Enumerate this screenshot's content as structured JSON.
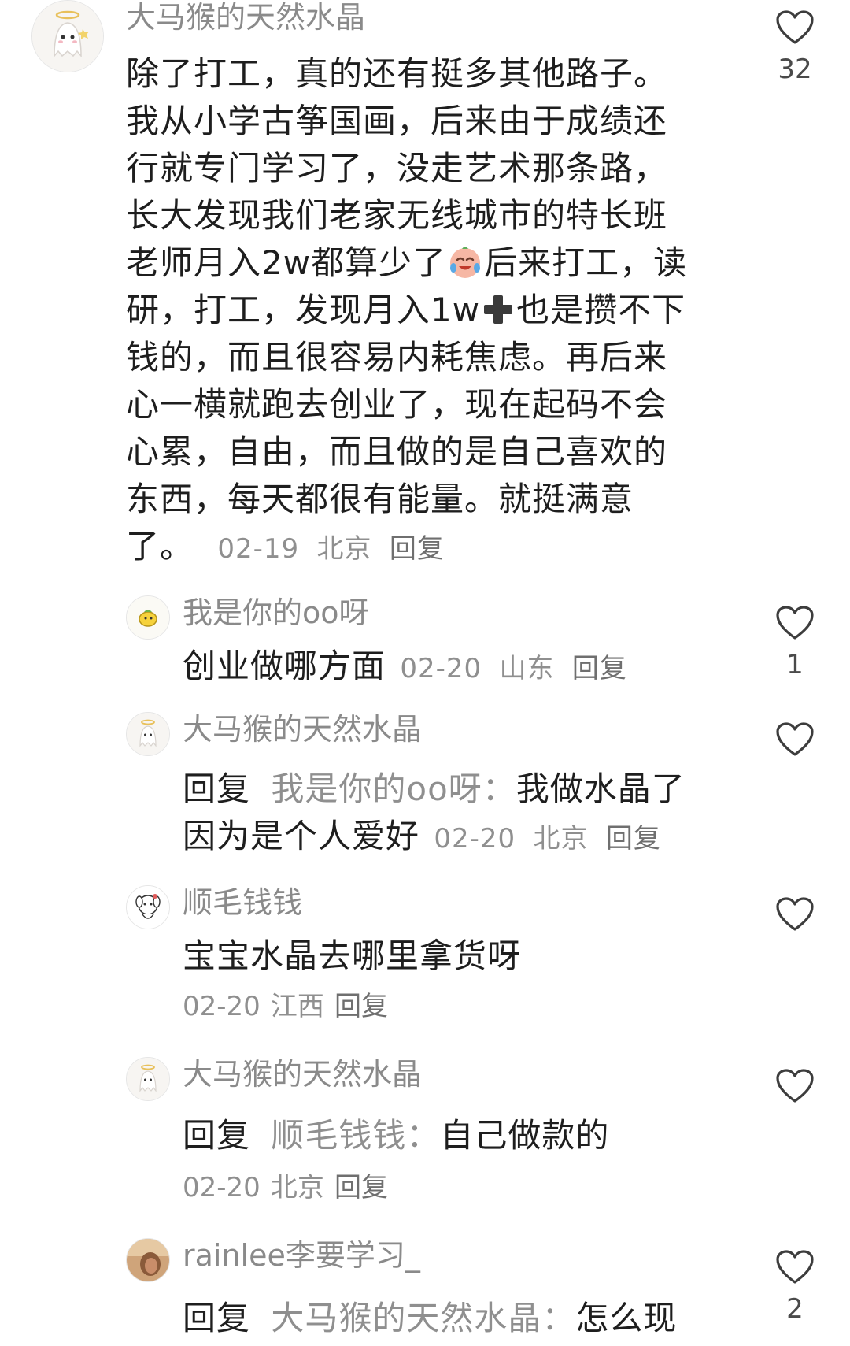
{
  "comments": [
    {
      "username": "大马猴的天然水晶",
      "text_lines": [
        "除了打工，真的还有挺多其他路子。",
        "我从小学古筝国画，后来由于成绩还",
        "行就专门学习了，没走艺术那条路，",
        "长大发现我们老家无线城市的特长班"
      ],
      "line5_before": "老师月入2w都算少了",
      "line5_after": "后来打工，读",
      "line6_before": "研，打工，发现月入1w",
      "line6_after": "也是攒不下",
      "text_lines_rest": [
        "钱的，而且很容易内耗焦虑。再后来",
        "心一横就跑去创业了，现在起码不会",
        "心累，自由，而且做的是自己喜欢的",
        "东西，每天都很有能量。就挺满意"
      ],
      "last_line": "了。",
      "date": "02-19",
      "location": "北京",
      "reply_label": "回复",
      "likes": "32"
    },
    {
      "username": "我是你的oo呀",
      "text": "创业做哪方面",
      "date": "02-20",
      "location": "山东",
      "reply_label": "回复",
      "likes": "1"
    },
    {
      "username": "大马猴的天然水晶",
      "reply_prefix": "回复",
      "reply_to": "我是你的oo呀：",
      "text_line1": "我做水晶了",
      "text_line2": "因为是个人爱好",
      "date": "02-20",
      "location": "北京",
      "reply_label": "回复",
      "likes": ""
    },
    {
      "username": "顺毛钱钱",
      "text": "宝宝水晶去哪里拿货呀",
      "date": "02-20",
      "location": "江西",
      "reply_label": "回复",
      "likes": ""
    },
    {
      "username": "大马猴的天然水晶",
      "reply_prefix": "回复",
      "reply_to": "顺毛钱钱：",
      "text": "自己做款的",
      "date": "02-20",
      "location": "北京",
      "reply_label": "回复",
      "likes": ""
    },
    {
      "username": "rainlee李要学习_",
      "reply_prefix": "回复",
      "reply_to": "大马猴的天然水晶：",
      "text": "怎么现",
      "likes": "2"
    }
  ],
  "icons": {
    "like": "heart-outline-icon",
    "emoji": "crying-laughing-face-emoji",
    "plus": "heavy-plus-emoji"
  },
  "colors": {
    "text": "#1e1e1e",
    "secondary": "#8f8f8f",
    "background": "#ffffff"
  }
}
